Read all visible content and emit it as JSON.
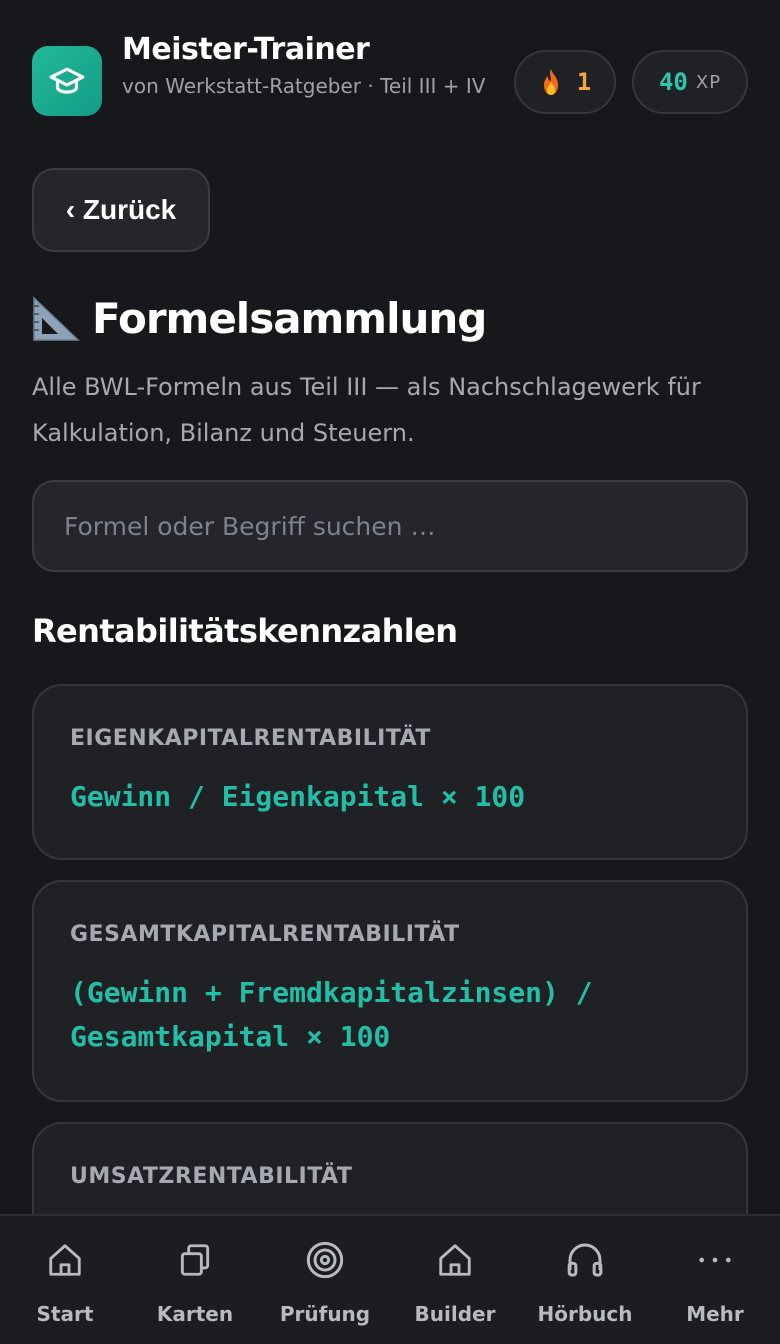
{
  "app": {
    "title": "Meister-Trainer",
    "subtitle": "von Werkstatt-Ratgeber · Teil III + IV"
  },
  "stats": {
    "streak_icon": "fire-icon",
    "streak": "1",
    "xp_value": "40",
    "xp_unit": "XP"
  },
  "back_label": "‹ Zurück",
  "page": {
    "emoji": "📐",
    "title": "Formelsammlung",
    "intro": "Alle BWL-Formeln aus Teil III — als Nachschlagewerk für Kalkulation, Bilanz und Steuern."
  },
  "search": {
    "placeholder": "Formel oder Begriff suchen …",
    "value": ""
  },
  "section": {
    "title": "Rentabilitätskennzahlen",
    "cards": [
      {
        "label": "EIGENKAPITALRENTABILITÄT",
        "formula": "Gewinn / Eigenkapital × 100"
      },
      {
        "label": "GESAMTKAPITALRENTABILITÄT",
        "formula": "(Gewinn + Fremdkapitalzinsen) / Gesamtkapital × 100"
      },
      {
        "label": "UMSATZRENTABILITÄT",
        "formula": ""
      }
    ]
  },
  "nav": [
    {
      "label": "Start",
      "icon": "home-icon"
    },
    {
      "label": "Karten",
      "icon": "cards-icon"
    },
    {
      "label": "Prüfung",
      "icon": "target-icon"
    },
    {
      "label": "Builder",
      "icon": "builder-icon"
    },
    {
      "label": "Hörbuch",
      "icon": "headphones-icon"
    },
    {
      "label": "Mehr",
      "icon": "more-icon"
    }
  ],
  "colors": {
    "background": "#17181b",
    "accent": "#22bfa6",
    "streak": "#f1a93b"
  }
}
